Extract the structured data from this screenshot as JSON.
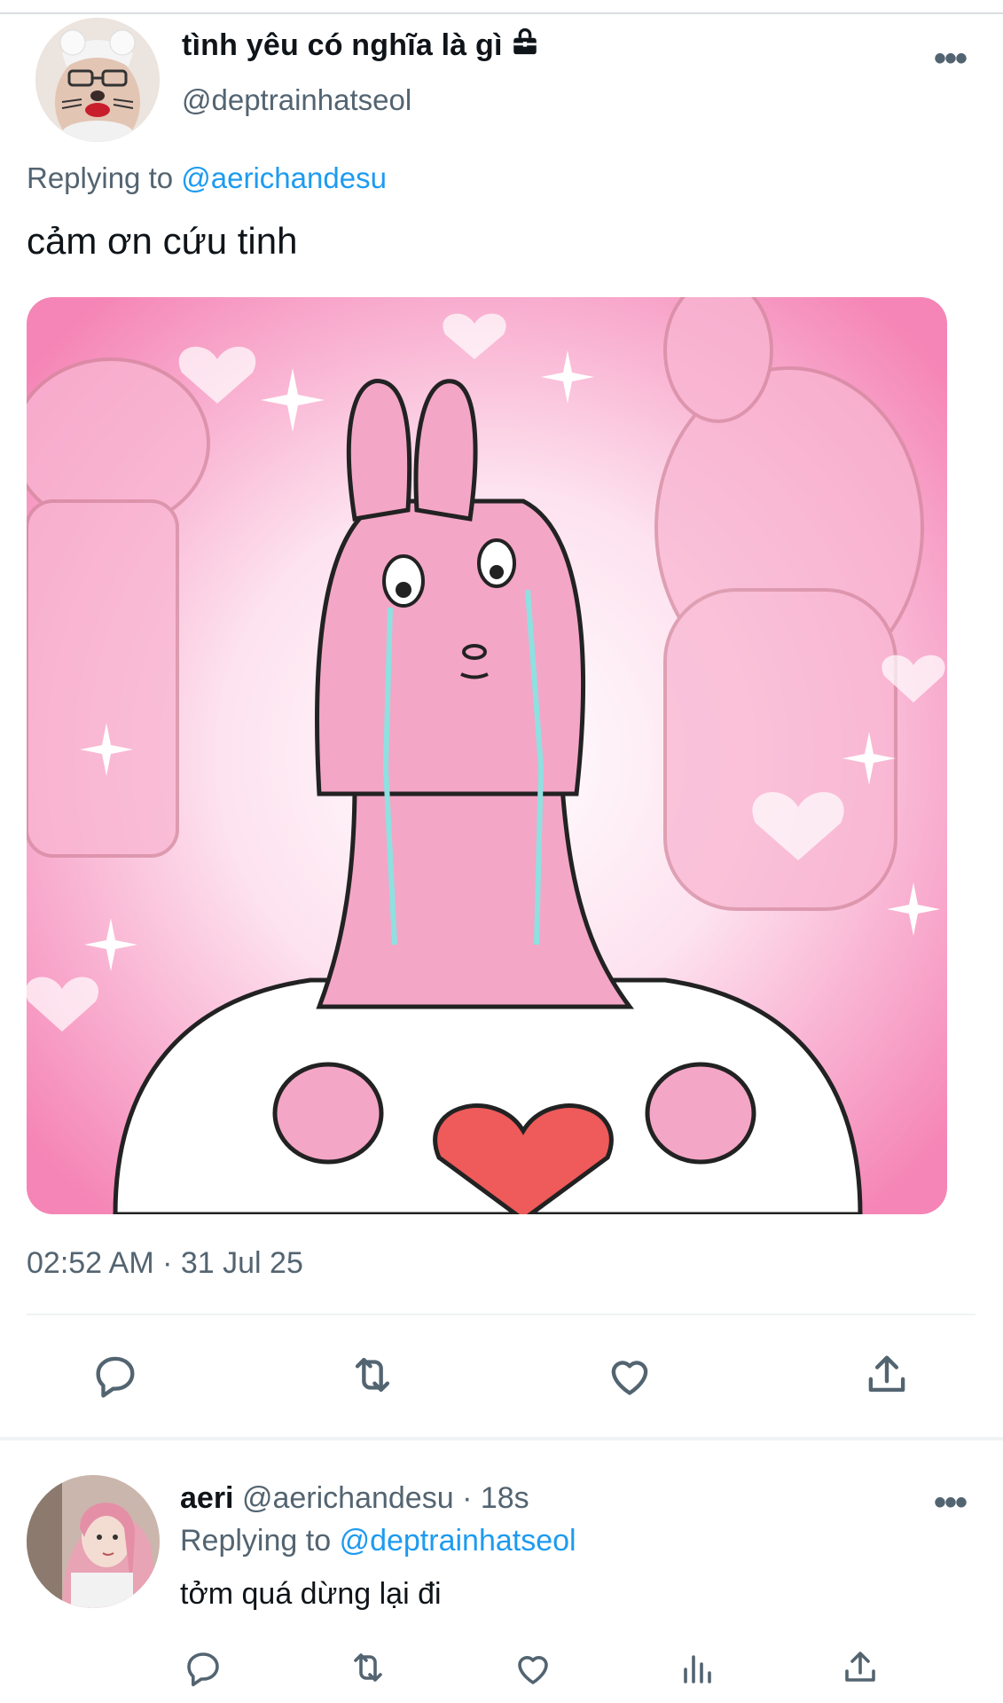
{
  "tweet": {
    "display_name": "tình yêu có nghĩa là gì",
    "lock_icon": "lock-icon",
    "handle": "@deptrainhatseol",
    "replying_prefix": "Replying to",
    "replying_to": "@aerichandesu",
    "text": "cảm ơn cứu tinh",
    "media_icon": "crying-pink-bunny-image",
    "timestamp": "02:52 AM · 31 Jul 25",
    "actions": [
      "reply-icon",
      "retweet-icon",
      "like-icon",
      "share-icon"
    ]
  },
  "reply": {
    "display_name": "aeri",
    "handle_time": "@aerichandesu · 18s",
    "replying_prefix": "Replying to",
    "replying_to": "@deptrainhatseol",
    "text": "tởm quá dừng lại đi",
    "actions": [
      "reply-icon",
      "retweet-icon",
      "like-icon",
      "views-icon",
      "share-icon"
    ]
  },
  "colors": {
    "accent": "#1d9bf0",
    "secondary_text": "#536471",
    "media_pink": "#f8a8cc"
  }
}
